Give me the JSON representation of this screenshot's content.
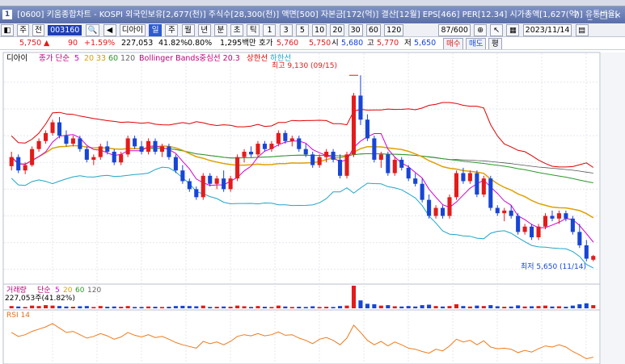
{
  "window": {
    "title": "[0600] 키움종합차트 - KOSPI 외국인보유[2,677(천)] 주식수[28,300(천)] 액면[500] 자본금[172(억)] 결산[12월] EPS[466] PER[12.34] 시가총액[1,627(억)] 유통비율[",
    "controls": [
      "?",
      "_",
      "□",
      "×"
    ]
  },
  "toolbar": {
    "market": "주",
    "all": "전",
    "code": "003160",
    "name": "디아이",
    "period_buttons": [
      "일",
      "주",
      "월",
      "년",
      "분",
      "초",
      "틱"
    ],
    "interval_buttons": [
      "1",
      "3",
      "5",
      "10",
      "20",
      "30",
      "60",
      "120"
    ],
    "count": "87/600",
    "date": "2023/11/14"
  },
  "quote": {
    "price": "5,750",
    "change": "90",
    "change_rate": "+1.59%",
    "volume": "227,053",
    "volume_ratio": "41.82%",
    "turnover": "0.80%",
    "amount": "1,295백만",
    "ask_label": "호가",
    "ask": "5,760",
    "bid": "5,750",
    "open_label": "시",
    "open": "5,680",
    "high_label": "고",
    "high": "5,770",
    "low_label": "저",
    "low": "5,650",
    "buy": "매수",
    "sell": "매도",
    "eval": "평"
  },
  "legend": {
    "name": "디아이",
    "ma_label": "종가 단순",
    "ma_periods": [
      "5",
      "20",
      "33",
      "60",
      "120"
    ],
    "bb_label": "Bollinger Bands중심선 20.3",
    "bb_upper": "상한선",
    "bb_lower": "하한선"
  },
  "annotations": {
    "high": "최고 9,130 (09/15)",
    "low": "최저 5,650 (11/14)"
  },
  "volume_panel": {
    "title": "거래량",
    "ma_label": "단순",
    "ma_periods": [
      "5",
      "20",
      "60",
      "120"
    ],
    "value": "227,053주(41.82%)"
  },
  "rsi_panel": {
    "title": "RSI 14"
  },
  "colors": {
    "up": "#e31b1b",
    "down": "#1745d6",
    "ma5": "#d400d4",
    "ma20": "#e0a000",
    "ma60": "#2a9a2a",
    "ma120": "#555555",
    "bb_mid": "#e0a000",
    "bb_upper": "#e00000",
    "bb_lower": "#20a6c8",
    "rsi": "#f07a1a"
  },
  "chart_data": {
    "type": "candlestick",
    "interval": "daily",
    "high_marker": {
      "value": 9130,
      "date": "09/15"
    },
    "low_marker": {
      "value": 5650,
      "date": "11/14"
    },
    "candles": [
      [
        7430,
        7700,
        7350,
        7600
      ],
      [
        7600,
        7650,
        7300,
        7350
      ],
      [
        7350,
        7500,
        7280,
        7450
      ],
      [
        7450,
        7800,
        7420,
        7750
      ],
      [
        7750,
        7950,
        7700,
        7900
      ],
      [
        7900,
        8100,
        7850,
        8050
      ],
      [
        8050,
        8300,
        8000,
        8250
      ],
      [
        8250,
        8350,
        7950,
        8000
      ],
      [
        8000,
        8100,
        7800,
        7850
      ],
      [
        7850,
        8000,
        7800,
        7950
      ],
      [
        7950,
        8000,
        7700,
        7750
      ],
      [
        7750,
        7800,
        7500,
        7550
      ],
      [
        7550,
        7650,
        7450,
        7600
      ],
      [
        7600,
        7850,
        7550,
        7800
      ],
      [
        7800,
        7900,
        7650,
        7700
      ],
      [
        7700,
        7750,
        7450,
        7500
      ],
      [
        7500,
        7700,
        7450,
        7650
      ],
      [
        7650,
        8000,
        7600,
        7950
      ],
      [
        7950,
        8000,
        7750,
        7800
      ],
      [
        7800,
        7900,
        7650,
        7700
      ],
      [
        7700,
        7950,
        7650,
        7900
      ],
      [
        7900,
        7950,
        7650,
        7700
      ],
      [
        7700,
        7850,
        7600,
        7800
      ],
      [
        7800,
        7850,
        7550,
        7600
      ],
      [
        7600,
        7650,
        7300,
        7350
      ],
      [
        7350,
        7450,
        7100,
        7150
      ],
      [
        7150,
        7200,
        6950,
        7000
      ],
      [
        7000,
        7050,
        6800,
        6850
      ],
      [
        6850,
        7300,
        6800,
        7250
      ],
      [
        7250,
        7300,
        7050,
        7100
      ],
      [
        7100,
        7250,
        7000,
        7200
      ],
      [
        7200,
        7350,
        6950,
        7000
      ],
      [
        7000,
        7250,
        6950,
        7200
      ],
      [
        7200,
        7650,
        7150,
        7600
      ],
      [
        7600,
        7750,
        7500,
        7700
      ],
      [
        7700,
        7800,
        7600,
        7650
      ],
      [
        7650,
        7900,
        7600,
        7850
      ],
      [
        7850,
        7900,
        7700,
        7750
      ],
      [
        7750,
        7900,
        7700,
        7850
      ],
      [
        7850,
        8100,
        7800,
        8050
      ],
      [
        8050,
        8100,
        7850,
        7900
      ],
      [
        7900,
        8000,
        7800,
        7950
      ],
      [
        7950,
        8000,
        7700,
        7750
      ],
      [
        7750,
        7850,
        7600,
        7650
      ],
      [
        7650,
        7700,
        7400,
        7450
      ],
      [
        7450,
        7650,
        7400,
        7600
      ],
      [
        7600,
        7750,
        7500,
        7700
      ],
      [
        7700,
        7750,
        7500,
        7550
      ],
      [
        7550,
        7650,
        7200,
        7250
      ],
      [
        7250,
        7700,
        7200,
        7650
      ],
      [
        7650,
        8800,
        7600,
        8750
      ],
      [
        8750,
        9130,
        8200,
        8300
      ],
      [
        8300,
        8400,
        7900,
        7950
      ],
      [
        7950,
        8000,
        7500,
        7550
      ],
      [
        7550,
        7700,
        7400,
        7650
      ],
      [
        7650,
        7700,
        7250,
        7300
      ],
      [
        7300,
        7600,
        7250,
        7550
      ],
      [
        7550,
        7600,
        7350,
        7400
      ],
      [
        7400,
        7450,
        7150,
        7200
      ],
      [
        7200,
        7300,
        7050,
        7100
      ],
      [
        7100,
        7200,
        6750,
        6800
      ],
      [
        6800,
        6900,
        6450,
        6500
      ],
      [
        6500,
        6700,
        6450,
        6650
      ],
      [
        6650,
        6700,
        6450,
        6500
      ],
      [
        6500,
        6900,
        6450,
        6850
      ],
      [
        6850,
        7350,
        6800,
        7300
      ],
      [
        7300,
        7400,
        7100,
        7150
      ],
      [
        7150,
        7350,
        7100,
        7300
      ],
      [
        7300,
        7350,
        6850,
        6900
      ],
      [
        6900,
        7250,
        6850,
        7200
      ],
      [
        7200,
        7250,
        6600,
        6650
      ],
      [
        6650,
        6700,
        6500,
        6550
      ],
      [
        6550,
        6650,
        6400,
        6600
      ],
      [
        6600,
        6700,
        6450,
        6500
      ],
      [
        6500,
        6550,
        6150,
        6200
      ],
      [
        6200,
        6350,
        6150,
        6300
      ],
      [
        6300,
        6350,
        6050,
        6100
      ],
      [
        6100,
        6350,
        6050,
        6300
      ],
      [
        6300,
        6550,
        6250,
        6500
      ],
      [
        6500,
        6600,
        6400,
        6450
      ],
      [
        6450,
        6600,
        6350,
        6550
      ],
      [
        6550,
        6600,
        6400,
        6450
      ],
      [
        6450,
        6500,
        6150,
        6200
      ],
      [
        6200,
        6350,
        5900,
        5950
      ],
      [
        5950,
        6050,
        5650,
        5700
      ],
      [
        5680,
        5770,
        5650,
        5750
      ]
    ],
    "volume_relative": [
      0.1,
      0.08,
      0.06,
      0.12,
      0.1,
      0.14,
      0.12,
      0.1,
      0.08,
      0.07,
      0.09,
      0.1,
      0.06,
      0.1,
      0.07,
      0.08,
      0.07,
      0.1,
      0.06,
      0.06,
      0.08,
      0.07,
      0.06,
      0.07,
      0.1,
      0.11,
      0.1,
      0.09,
      0.12,
      0.06,
      0.07,
      0.08,
      0.07,
      0.12,
      0.09,
      0.06,
      0.1,
      0.07,
      0.06,
      0.12,
      0.08,
      0.06,
      0.07,
      0.06,
      0.09,
      0.06,
      0.07,
      0.06,
      0.1,
      0.12,
      1.0,
      0.35,
      0.2,
      0.18,
      0.12,
      0.14,
      0.09,
      0.08,
      0.1,
      0.08,
      0.14,
      0.16,
      0.1,
      0.08,
      0.1,
      0.18,
      0.1,
      0.08,
      0.12,
      0.1,
      0.14,
      0.09,
      0.07,
      0.08,
      0.13,
      0.08,
      0.09,
      0.1,
      0.12,
      0.08,
      0.09,
      0.07,
      0.12,
      0.18,
      0.22,
      0.14
    ],
    "rsi": [
      62,
      55,
      58,
      64,
      68,
      72,
      78,
      70,
      62,
      64,
      58,
      52,
      55,
      60,
      56,
      50,
      54,
      62,
      57,
      54,
      58,
      53,
      55,
      50,
      44,
      40,
      37,
      34,
      46,
      42,
      45,
      40,
      46,
      55,
      58,
      56,
      60,
      56,
      58,
      63,
      57,
      58,
      52,
      48,
      42,
      50,
      53,
      48,
      40,
      52,
      75,
      62,
      48,
      40,
      46,
      38,
      45,
      40,
      34,
      32,
      28,
      25,
      32,
      29,
      38,
      50,
      45,
      48,
      40,
      47,
      36,
      33,
      34,
      32,
      26,
      30,
      27,
      33,
      38,
      36,
      40,
      36,
      28,
      22,
      15,
      18
    ]
  }
}
